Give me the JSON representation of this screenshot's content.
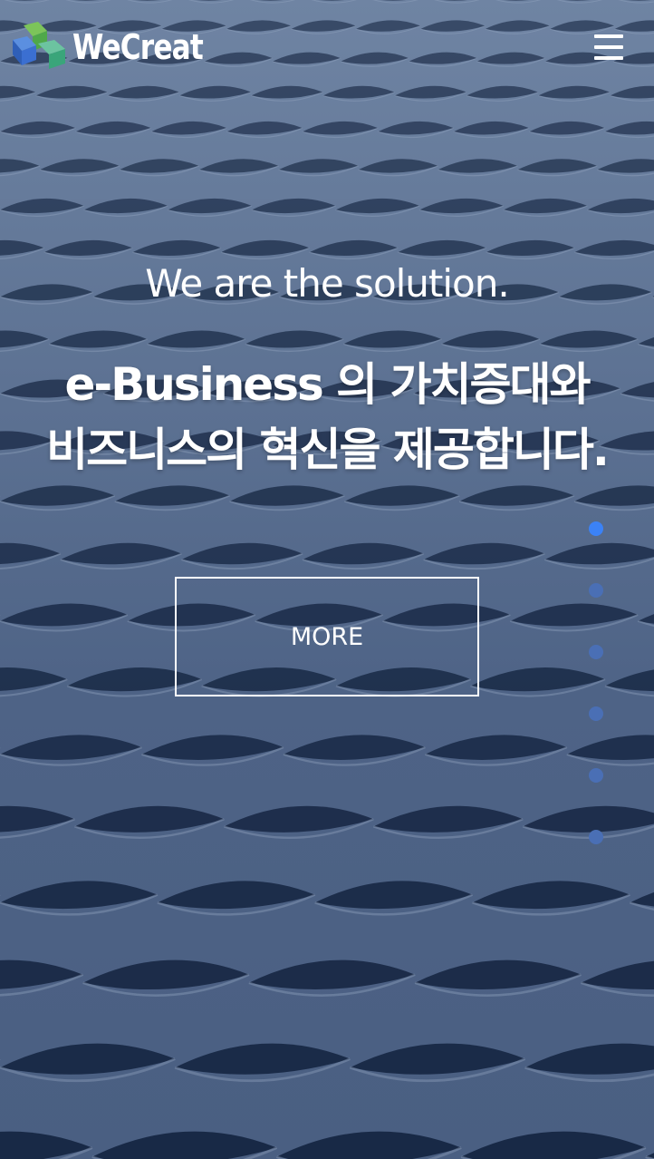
{
  "header": {
    "logo_text": "WeCreat",
    "logo_icon": "cube-logo-icon",
    "menu_icon": "hamburger-menu-icon"
  },
  "hero": {
    "tagline": "We are the solution.",
    "headline_line1": "e-Business 의 가치증대와",
    "headline_line2": "비즈니스의 혁신을 제공합니다.",
    "more_label": "MORE"
  },
  "pager": {
    "count": 6,
    "active_index": 0
  },
  "colors": {
    "background": "#5c7192",
    "text": "#ffffff",
    "active_dot": "#3b82f6",
    "inactive_dot": "#4a6fb5",
    "logo_green": "#4caf50",
    "logo_blue": "#3b6fd1"
  }
}
